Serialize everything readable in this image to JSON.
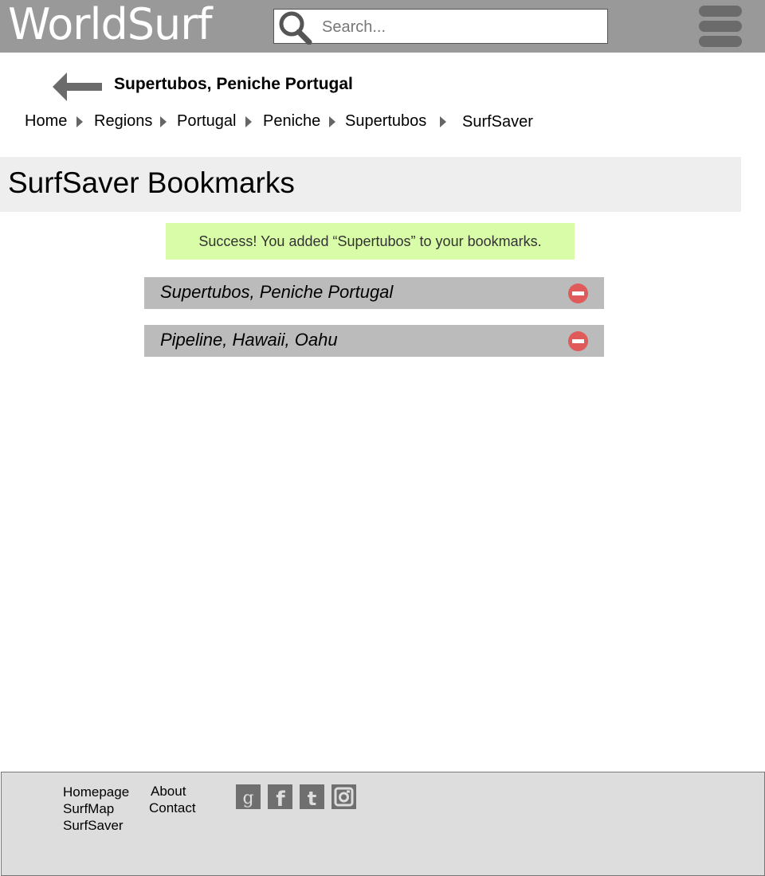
{
  "header": {
    "logo": "WorldSurf",
    "search_placeholder": "Search..."
  },
  "spot_title": "Supertubos, Peniche Portugal",
  "breadcrumb": [
    "Home",
    "Regions",
    "Portugal",
    "Peniche",
    "Supertubos",
    "SurfSaver"
  ],
  "page_title": "SurfSaver Bookmarks",
  "success_message": "Success! You added “Supertubos” to your bookmarks.",
  "bookmarks": [
    {
      "label": "Supertubos, Peniche Portugal",
      "action_icon": "remove-icon"
    },
    {
      "label": "Pipeline, Hawaii, Oahu",
      "action_icon": "remove-icon"
    }
  ],
  "footer": {
    "col1": [
      "Homepage",
      "SurfMap",
      "SurfSaver"
    ],
    "col2": [
      "About",
      "Contact"
    ],
    "social": [
      "google-plus-icon",
      "facebook-icon",
      "twitter-icon",
      "instagram-icon"
    ]
  },
  "colors": {
    "header_bg": "#999999",
    "success_bg": "#d9fca8",
    "bookmark_bg": "#bbbbbb",
    "remove_icon": "#e05a5a",
    "footer_bg": "#dddddd"
  }
}
